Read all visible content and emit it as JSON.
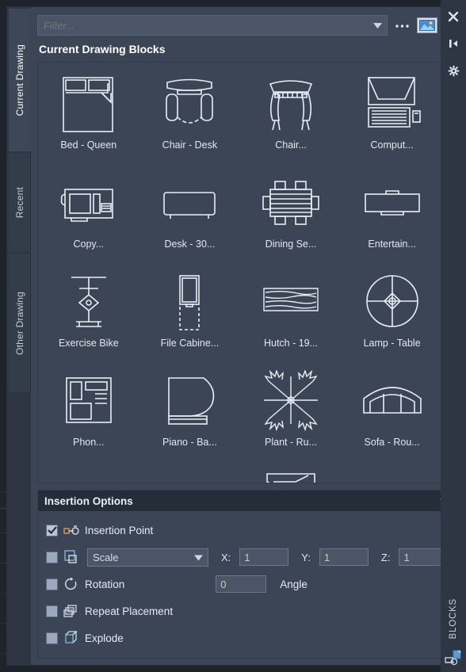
{
  "window": {
    "palette_name": "BLOCKS",
    "close_icon": "close-icon",
    "autohide_icon": "auto-hide-icon",
    "properties_icon": "properties-icon",
    "blocks_status_icon": "blocks-icon"
  },
  "tabs": [
    {
      "label": "Current Drawing",
      "active": true
    },
    {
      "label": "Recent",
      "active": false
    },
    {
      "label": "Other Drawing",
      "active": false
    }
  ],
  "toolbar": {
    "filter_placeholder": "Filter...",
    "filter_value": "",
    "filter_caret_icon": "chevron-down-icon",
    "more_options_label": "...",
    "thumbnail_icon": "image-thumbnail-icon",
    "thumbnail_caret_icon": "chevron-down-icon"
  },
  "section": {
    "title": "Current Drawing Blocks"
  },
  "blocks": [
    {
      "label": "Bed - Queen",
      "icon": "bed-queen-block"
    },
    {
      "label": "Chair - Desk",
      "icon": "chair-desk-block"
    },
    {
      "label": "Chair...",
      "icon": "chair-block"
    },
    {
      "label": "Comput...",
      "icon": "computer-block"
    },
    {
      "label": "Copy...",
      "icon": "copier-block"
    },
    {
      "label": "Desk - 30...",
      "icon": "desk-block"
    },
    {
      "label": "Dining Se...",
      "icon": "dining-set-block"
    },
    {
      "label": "Entertain...",
      "icon": "entertainment-center-block"
    },
    {
      "label": "Exercise Bike",
      "icon": "exercise-bike-block"
    },
    {
      "label": "File Cabine...",
      "icon": "file-cabinet-block"
    },
    {
      "label": "Hutch - 19...",
      "icon": "hutch-block"
    },
    {
      "label": "Lamp - Table",
      "icon": "lamp-table-block"
    },
    {
      "label": "Phon...",
      "icon": "phone-block"
    },
    {
      "label": "Piano - Ba...",
      "icon": "piano-baby-grand-block"
    },
    {
      "label": "Plant - Ru...",
      "icon": "plant-block"
    },
    {
      "label": "Sofa - Rou...",
      "icon": "sofa-block"
    }
  ],
  "scrollbar": {
    "up_icon": "chevron-up-icon",
    "down_icon": "chevron-down-icon",
    "thumb_position_percent": 0,
    "thumb_size_percent": 84
  },
  "insertion_options": {
    "title": "Insertion Options",
    "collapse_icon": "chevron-down-icon",
    "rows": {
      "insertion_point": {
        "label": "Insertion Point",
        "checked": true,
        "icon": "insertion-point-icon"
      },
      "scale": {
        "label": "Scale",
        "checked": false,
        "icon": "scale-icon",
        "x_label": "X:",
        "x_value": "1",
        "y_label": "Y:",
        "y_value": "1",
        "z_label": "Z:",
        "z_value": "1"
      },
      "rotation": {
        "label": "Rotation",
        "checked": false,
        "icon": "rotation-icon",
        "value": "0",
        "angle_label": "Angle"
      },
      "repeat": {
        "label": "Repeat Placement",
        "checked": false,
        "icon": "repeat-placement-icon"
      },
      "explode": {
        "label": "Explode",
        "checked": false,
        "icon": "explode-icon"
      }
    }
  },
  "colors": {
    "palette_bg": "#3c4555",
    "tab_bg": "#2e3643",
    "header_bg": "#262d38",
    "field_bg": "#4a5568",
    "text": "#e6ebf2",
    "value_text": "#d9c9a6",
    "checkbox": "#9aa8c0",
    "accent_blue": "#5b9bd5",
    "scrollbar_track": "#f0f0f0",
    "scrollbar_thumb": "#cdcdcd"
  }
}
